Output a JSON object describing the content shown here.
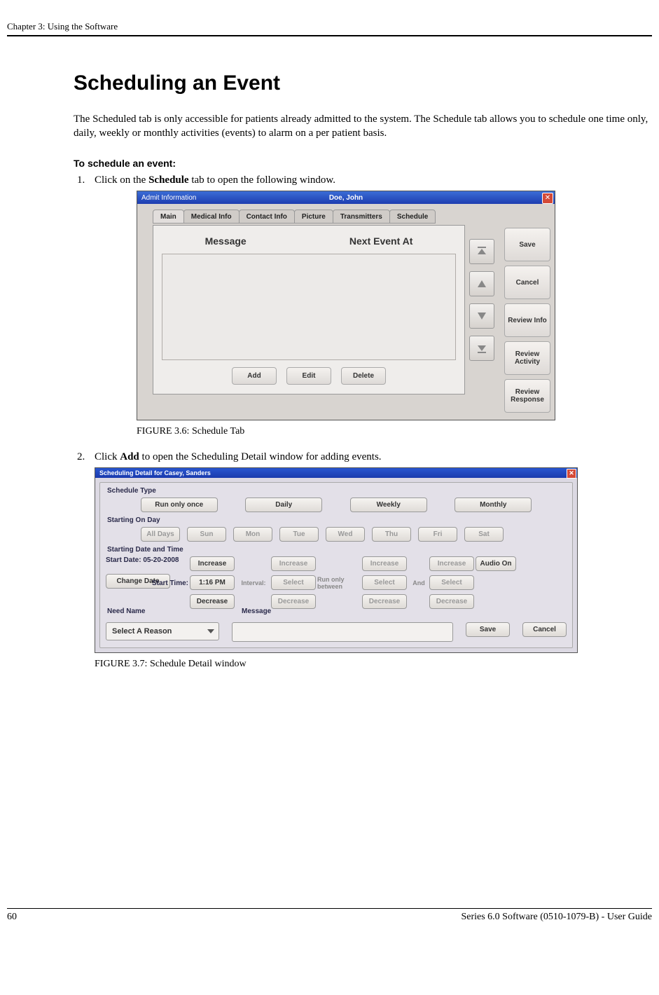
{
  "header": {
    "chapter": "Chapter 3: Using the Software"
  },
  "title": "Scheduling an Event",
  "intro": "The Scheduled tab is only accessible for patients already admitted to the system. The Schedule tab allows you to schedule one time only, daily, weekly or monthly activities (events) to alarm on a per patient basis.",
  "subhead": "To schedule an event:",
  "steps": {
    "s1_a": "Click on the ",
    "s1_b": "Schedule",
    "s1_c": " tab to open the following window.",
    "s2_a": "Click ",
    "s2_b": "Add",
    "s2_c": " to open the Scheduling Detail window for adding events."
  },
  "fig36": {
    "caption": "FIGURE 3.6:    Schedule Tab",
    "titlebar_left": "Admit Information",
    "titlebar_center": "Doe, John",
    "tabs": [
      "Main",
      "Medical Info",
      "Contact Info",
      "Picture",
      "Transmitters",
      "Schedule"
    ],
    "col1": "Message",
    "col2": "Next Event At",
    "buttons": {
      "add": "Add",
      "edit": "Edit",
      "delete": "Delete"
    },
    "side": {
      "save": "Save",
      "cancel": "Cancel",
      "reviewinfo": "Review Info",
      "reviewactivity": "Review Activity",
      "reviewresponse": "Review Response"
    }
  },
  "fig37": {
    "caption": "FIGURE 3.7:    Schedule Detail window",
    "titlebar": "Scheduling Detail for Casey, Sanders",
    "schedtype_label": "Schedule Type",
    "schedtypes": [
      "Run only once",
      "Daily",
      "Weekly",
      "Monthly"
    ],
    "startday_label": "Starting On Day",
    "days": [
      "All Days",
      "Sun",
      "Mon",
      "Tue",
      "Wed",
      "Thu",
      "Fri",
      "Sat"
    ],
    "datetime_label": "Starting Date and Time",
    "startdate_label": "Start Date: 05-20-2008",
    "changedate": "Change Date",
    "starttime_label": "Start Time:",
    "starttime_value": "1:16 PM",
    "increase": "Increase",
    "decrease": "Decrease",
    "select": "Select",
    "interval": "Interval:",
    "runonly": "Run only between",
    "and": "And",
    "audio": "Audio On",
    "needname": "Need Name",
    "message": "Message",
    "selectreason": "Select A Reason",
    "save": "Save",
    "cancel": "Cancel"
  },
  "footer": {
    "page": "60",
    "right": "Series 6.0 Software (0510-1079-B) - User Guide"
  }
}
